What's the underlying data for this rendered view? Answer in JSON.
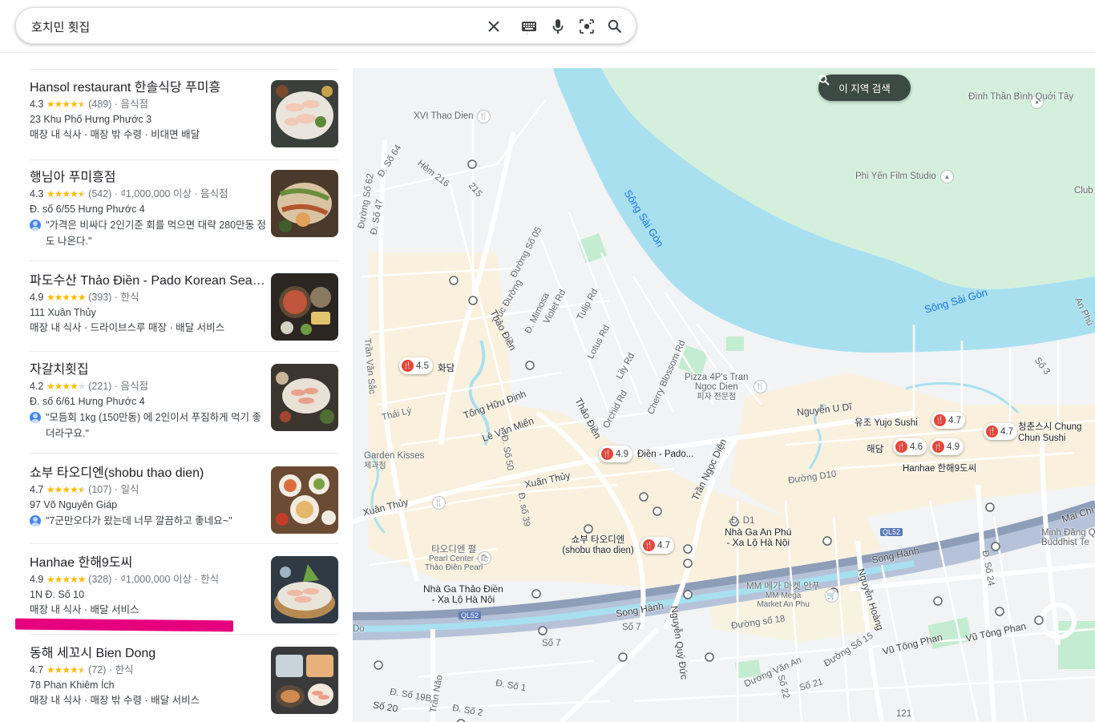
{
  "search": {
    "query": "호치민 횟집"
  },
  "icons": [
    "close-icon",
    "keyboard-icon",
    "mic-icon",
    "lens-icon",
    "search-icon"
  ],
  "results": [
    {
      "name": "Hansol restaurant 한솔식당 푸미흥",
      "rating": "4.3",
      "stars": 4.3,
      "count": "(489)",
      "price": "",
      "category": "음식점",
      "address": "23 Khu Phố Hưng Phước 3",
      "extra": "매장 내 식사 · 매장 밖 수령 · 비대면 배달",
      "review": ""
    },
    {
      "name": "행님아 푸미흥점",
      "rating": "4.3",
      "stars": 4.3,
      "count": "(542)",
      "price": "₫1,000,000 이상",
      "category": "음식점",
      "address": "Đ. số 6/55 Hưng Phước 4",
      "extra": "",
      "review": "\"가격은 비싸다 2인기준 회를 먹으면 대략 280만동 정도 나온다.\""
    },
    {
      "name": "파도수산 Thảo Điền - Pado Korean Seafood…",
      "rating": "4.9",
      "stars": 4.9,
      "count": "(393)",
      "price": "",
      "category": "한식",
      "address": "111 Xuân Thủy",
      "extra": "매장 내 식사 · 드라이브스루 매장 · 배달 서비스",
      "review": ""
    },
    {
      "name": "자갈치횟집",
      "rating": "4.2",
      "stars": 4.2,
      "count": "(221)",
      "price": "",
      "category": "음식점",
      "address": "Đ. số 6/61 Hưng Phước 4",
      "extra": "",
      "review": "\"모듬회 1kg (150만동) 에 2인이서 푸짐하게 먹기 좋더라구요.\""
    },
    {
      "name": "쇼부 타오디엔(shobu thao dien)",
      "rating": "4.7",
      "stars": 4.7,
      "count": "(107)",
      "price": "",
      "category": "일식",
      "address": "97 Võ Nguyên Giáp",
      "extra": "",
      "review": "\"7군만오다가 왔는데 너무 깔끔하고 좋네요~\""
    },
    {
      "name": "Hanhae 한해9도씨",
      "rating": "4.9",
      "stars": 4.9,
      "count": "(328)",
      "price": "₫1,000,000 이상",
      "category": "한식",
      "address": "1N Đ. Số 10",
      "extra": "매장 내 식사 · 배달 서비스",
      "review": ""
    },
    {
      "name": "동해 세꼬시 Bien Dong",
      "rating": "4.7",
      "stars": 4.7,
      "count": "(72)",
      "price": "",
      "category": "한식",
      "address": "78 Phan Khiêm Ích",
      "extra": "매장 내 식사 · 매장 밖 수령 · 배달 서비스",
      "review": ""
    }
  ],
  "map": {
    "search_area_button": "이 지역 검색",
    "pins": [
      {
        "rating": "4.5",
        "name": "화담"
      },
      {
        "rating": "4.9",
        "name": "Điền - Pado..."
      },
      {
        "rating": "4.7",
        "name": "유조 Yujo Sushi"
      },
      {
        "rating": "4.6",
        "name": "해담"
      },
      {
        "rating": "4.9",
        "name": "Hanhae 한해9도씨"
      },
      {
        "rating": "4.7",
        "name": "청춘스시 Chung Chun Sushi"
      },
      {
        "rating": "4.7",
        "name": "쇼부 타오디엔 (shobu thao dien)"
      }
    ],
    "labels": {
      "river1": "Sông Sài Gòn",
      "river2": "Sông Sài Gòn",
      "dinh": "Đình Thần Bình Quới Tây",
      "phiyen": "Phi Yến Film Studio",
      "club": "Club",
      "xvi": "XVI Thao Dien",
      "pizza1": "Pizza 4P's Tran",
      "pizza2": "Ngoc Dien",
      "pizza3": "피자 전문점",
      "nguyenudi": "Nguyễn U Dĩ",
      "garden1": "Garden Kisses",
      "garden2": "제과점",
      "xuanthuy1": "Xuân Thủy",
      "xuanthuy2": "Xuân Thủy",
      "levanmien": "Lê Văn Miến",
      "tonghuudinh": "Tống Hữu Định",
      "thaily": "Thái Lý",
      "tranngocdien": "Trần Ngọc Diện",
      "duong10": "Đường D10",
      "pearl1": "타오디엔 펄",
      "pearl2": "Pearl Center -",
      "pearl3": "Thảo Điền Pearl",
      "station1a": "Nhà Ga Thảo Điền",
      "station1b": "- Xa Lộ Hà Nội",
      "station2a": "Nhà Ga An Phú",
      "station2b": "- Xa Lộ Hà Nội",
      "mm1": "MM 메가 마켓 안푸",
      "mm2": "MM Mega",
      "mm3": "Market An Phu",
      "songhanh1": "Song Hành",
      "songhanh2": "Song Hành",
      "ql52a": "QL52",
      "ql52b": "QL52",
      "vutongphan": "Vũ Tông Phan",
      "vutongphan2": "Vũ Tông Phan",
      "minhdang1": "Minh Đăng Q",
      "minhdang2": "Buddhist Te",
      "maichi": "Mai Chí",
      "duong18": "Đường số 18",
      "duongvanan": "Dương Văn An",
      "tranvansac": "Trần Văn Sắc",
      "hem216": "Hẻm 216",
      "r215": "215",
      "violet": "Violet Rd",
      "tulip": "Tulip Rd",
      "lotus": "Lotus Rd",
      "lily": "Lily Rd",
      "orchid": "Orchid Rd",
      "cherry": "Cherry Blossom Rd",
      "mimosa": "Đ. Mimosa",
      "trucduong": "Trúc Đường",
      "thaodien1": "Thảo Điền",
      "thaodien2": "Thảo Điền",
      "duongso05": "Đường Số 05",
      "so7a": "Số 7",
      "so7b": "Số 7",
      "so20": "Số 20",
      "nguyenquyduc": "Nguyễn Quý Đức",
      "nguyenhoang": "Nguyễn Hoàng",
      "do": "Do",
      "d1": "Đ. D1",
      "so24": "Đ. Số 24",
      "so15": "Đường Số 15",
      "so21": "Số 21",
      "so22": "Số 22",
      "n121": "121",
      "anphu": "An Phú",
      "so3": "Số 3",
      "tranbao": "Trần Não",
      "so2": "Đ. Số 2",
      "so1b": "Đ. Số 1",
      "so19b": "Đ. Số 19B",
      "so39": "Đ. số 39",
      "so50": "Đ. Số 50",
      "so62": "Đường Số 62",
      "so47": "Đ. Số 47",
      "so64": "Đ. Số 64"
    }
  }
}
